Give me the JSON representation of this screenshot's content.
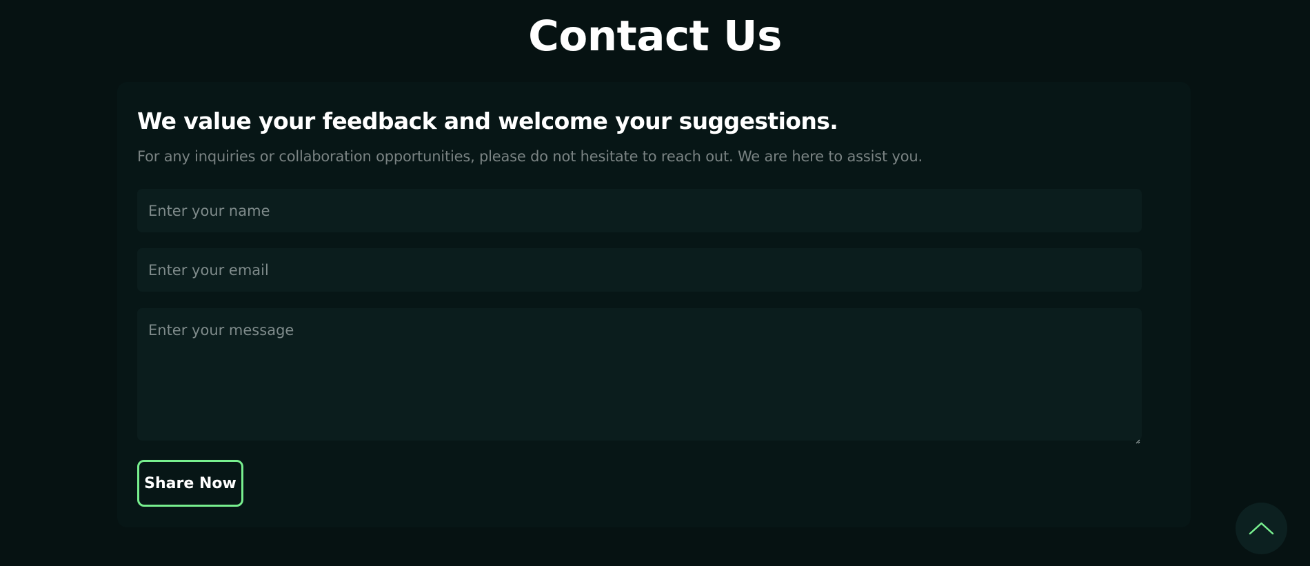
{
  "page": {
    "title": "Contact Us"
  },
  "contact_form": {
    "heading": "We value your feedback and welcome your suggestions.",
    "description": "For any inquiries or collaboration opportunities, please do not hesitate to reach out. We are here to assist you.",
    "name_field": {
      "value": "",
      "placeholder": "Enter your name"
    },
    "email_field": {
      "value": "",
      "placeholder": "Enter your email"
    },
    "message_field": {
      "value": "",
      "placeholder": "Enter your message"
    },
    "submit_label": "Share Now"
  },
  "scroll_top": {
    "icon": "chevron-up-icon"
  },
  "colors": {
    "background": "#061212",
    "card": "#071616",
    "field": "#0b1d1d",
    "accent": "#78ef8f",
    "muted_text": "#7a8383"
  },
  "icons": {
    "resize_handle": "resize-handle-icon"
  }
}
